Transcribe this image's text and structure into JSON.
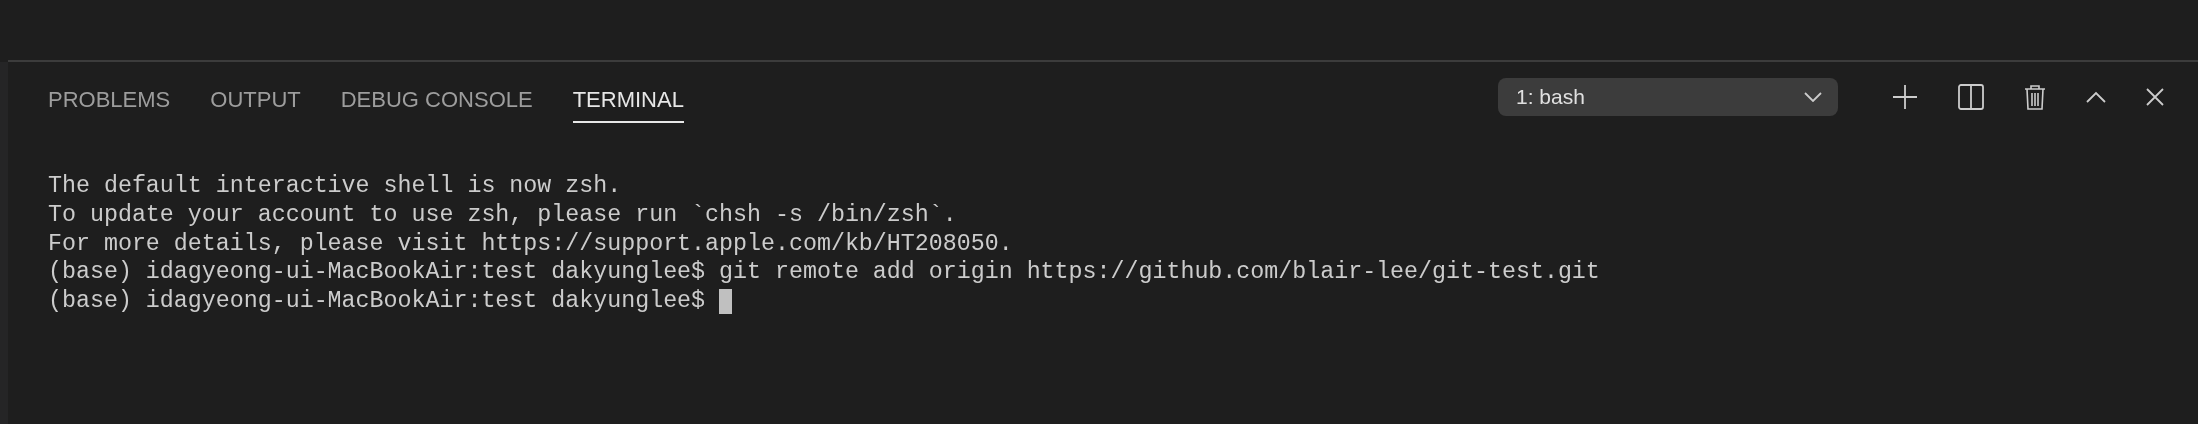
{
  "tabs": [
    {
      "label": "PROBLEMS",
      "selected": false
    },
    {
      "label": "OUTPUT",
      "selected": false
    },
    {
      "label": "DEBUG CONSOLE",
      "selected": false
    },
    {
      "label": "TERMINAL",
      "selected": true
    }
  ],
  "terminal_selector": {
    "value": "1: bash"
  },
  "terminal": {
    "lines": [
      {
        "text": "The default interactive shell is now zsh.",
        "cursor": false
      },
      {
        "text": "To update your account to use zsh, please run `chsh -s /bin/zsh`.",
        "cursor": false
      },
      {
        "text": "For more details, please visit https://support.apple.com/kb/HT208050.",
        "cursor": false
      },
      {
        "text": "(base) idagyeong-ui-MacBookAir:test dakyunglee$ git remote add origin https://github.com/blair-lee/git-test.git",
        "cursor": false
      },
      {
        "text": "(base) idagyeong-ui-MacBookAir:test dakyunglee$ ",
        "cursor": true
      }
    ]
  }
}
